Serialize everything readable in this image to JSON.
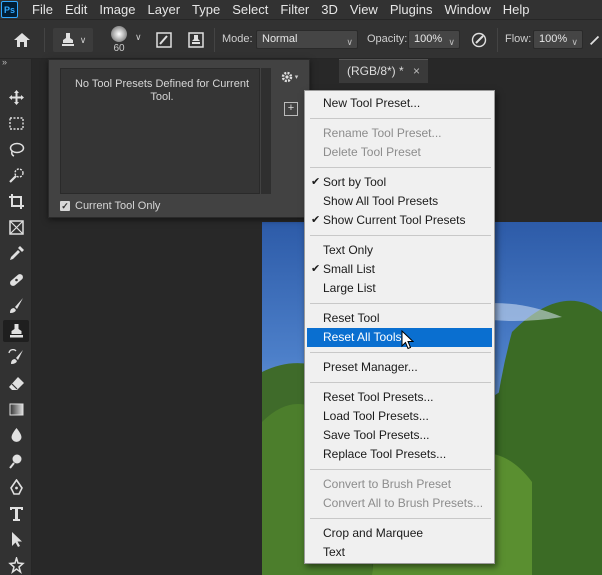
{
  "app": {
    "logo": "Ps"
  },
  "menu": [
    "File",
    "Edit",
    "Image",
    "Layer",
    "Type",
    "Select",
    "Filter",
    "3D",
    "View",
    "Plugins",
    "Window",
    "Help"
  ],
  "options": {
    "brush_size": "60",
    "mode_label": "Mode:",
    "mode_value": "Normal",
    "opacity_label": "Opacity:",
    "opacity_value": "100%",
    "flow_label": "Flow:",
    "flow_value": "100%"
  },
  "document": {
    "tab_title": "(RGB/8*) *",
    "tab_close": "×"
  },
  "presets_panel": {
    "empty_message": "No Tool Presets Defined for Current Tool.",
    "current_tool_only": "Current Tool Only"
  },
  "context_menu": {
    "items": [
      {
        "label": "New Tool Preset...",
        "state": "enabled"
      },
      {
        "label": "Rename Tool Preset...",
        "state": "disabled"
      },
      {
        "label": "Delete Tool Preset",
        "state": "disabled"
      },
      {
        "label": "Sort by Tool",
        "state": "checked"
      },
      {
        "label": "Show All Tool Presets",
        "state": "enabled"
      },
      {
        "label": "Show Current Tool Presets",
        "state": "checked"
      },
      {
        "label": "Text Only",
        "state": "enabled"
      },
      {
        "label": "Small List",
        "state": "checked"
      },
      {
        "label": "Large List",
        "state": "enabled"
      },
      {
        "label": "Reset Tool",
        "state": "enabled"
      },
      {
        "label": "Reset All Tools",
        "state": "highlighted"
      },
      {
        "label": "Preset Manager...",
        "state": "enabled"
      },
      {
        "label": "Reset Tool Presets...",
        "state": "enabled"
      },
      {
        "label": "Load Tool Presets...",
        "state": "enabled"
      },
      {
        "label": "Save Tool Presets...",
        "state": "enabled"
      },
      {
        "label": "Replace Tool Presets...",
        "state": "enabled"
      },
      {
        "label": "Convert to Brush Preset",
        "state": "disabled"
      },
      {
        "label": "Convert All to Brush Presets...",
        "state": "disabled"
      },
      {
        "label": "Crop and Marquee",
        "state": "enabled"
      },
      {
        "label": "Text",
        "state": "enabled"
      }
    ],
    "check_glyph": "✔"
  },
  "icons": {
    "toolbar": [
      "move-icon",
      "marquee-icon",
      "lasso-icon",
      "quick-select-icon",
      "crop-icon",
      "frame-icon",
      "eyedropper-icon",
      "healing-brush-icon",
      "brush-icon",
      "clone-stamp-icon",
      "history-brush-icon",
      "eraser-icon",
      "gradient-icon",
      "blur-icon",
      "dodge-icon",
      "pen-icon",
      "type-icon",
      "path-select-icon",
      "shape-icon"
    ]
  },
  "colors": {
    "highlight": "#0a6fd0",
    "panel": "#424242",
    "chrome": "#323232"
  }
}
